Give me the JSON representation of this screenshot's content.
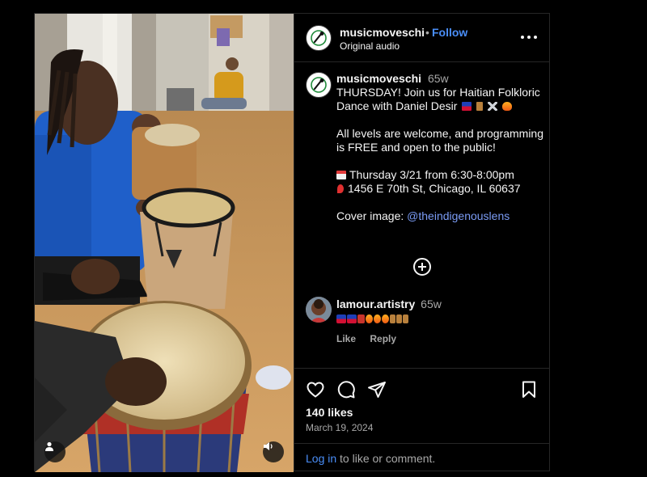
{
  "post": {
    "username": "musicmoveschi",
    "follow_label": "Follow",
    "separator": "•",
    "audio_label": "Original audio"
  },
  "caption": {
    "username": "musicmoveschi",
    "time": "65w",
    "line1": "THURSDAY! Join us for Haitian Folkloric Dance with Daniel Desir",
    "line2": "All levels are welcome, and programming is FREE and open to the public!",
    "line3": "Thursday 3/21 from 6:30-8:00pm",
    "line4": "1456 E 70th St, Chicago, IL 60637",
    "cover_prefix": "Cover image:",
    "mention": "@theindigenouslens",
    "icons": [
      "haiti-flag-icon",
      "drum-icon",
      "crossed-swords-icon",
      "fire-icon",
      "calendar-icon",
      "pin-icon"
    ]
  },
  "comment": {
    "username": "lamour.artistry",
    "time": "65w",
    "emoji_icons": [
      "haiti-flag-icon",
      "haiti-flag-icon",
      "dancer-icon",
      "fire-icon",
      "fire-icon",
      "fire-icon",
      "drum-icon",
      "drum-icon",
      "drum-icon"
    ],
    "like_label": "Like",
    "reply_label": "Reply"
  },
  "footer": {
    "likes": "140 likes",
    "date": "March 19, 2024",
    "login_link": "Log in",
    "login_suffix": "to like or comment."
  },
  "colors": {
    "link": "#4a8ef8",
    "mention": "#7b9cf5",
    "muted": "#a8a8a8",
    "border": "#262626"
  }
}
